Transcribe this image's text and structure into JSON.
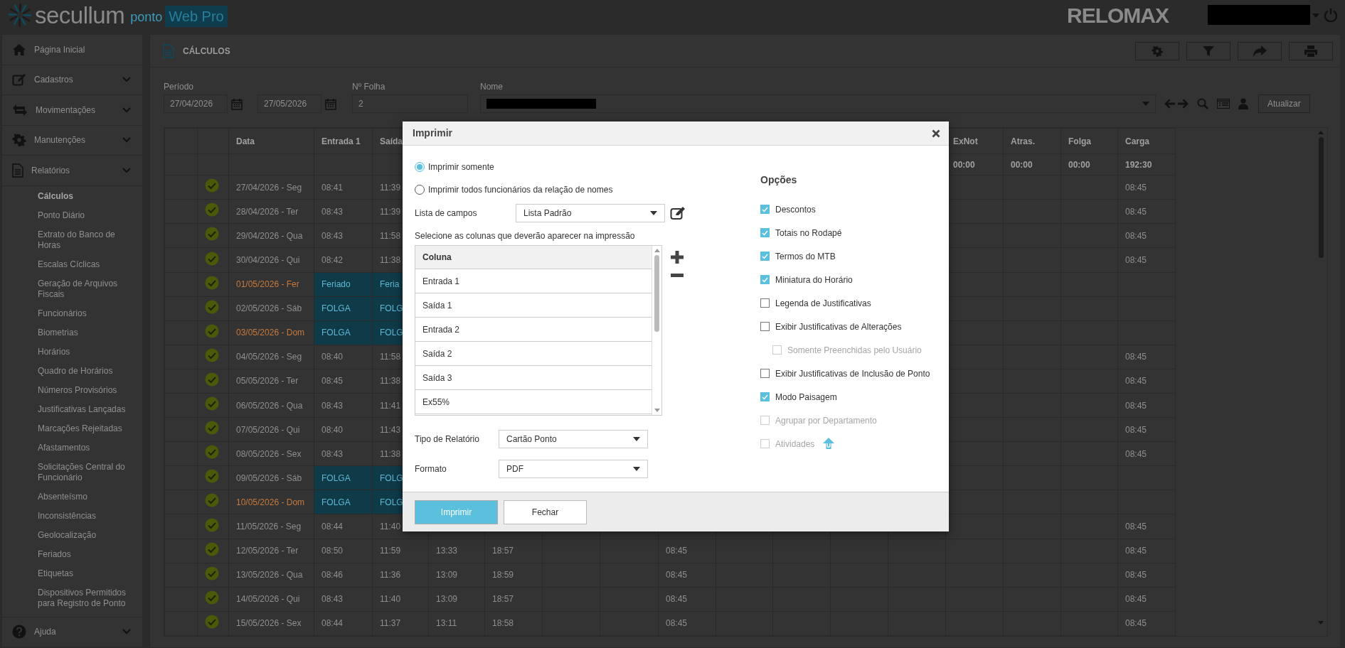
{
  "header": {
    "brand": "secullum",
    "product": "ponto",
    "edition": "Web Pro",
    "partner": "RELOMAX"
  },
  "sidebar": {
    "items": [
      {
        "label": "Página Inicial"
      },
      {
        "label": "Cadastros",
        "expanded": false
      },
      {
        "label": "Movimentações",
        "expanded": false
      },
      {
        "label": "Manutenções",
        "expanded": false
      },
      {
        "label": "Relatórios",
        "expanded": true,
        "children": [
          {
            "label": "Cálculos",
            "selected": true
          },
          {
            "label": "Ponto Diário",
            "selected": false
          },
          {
            "label": "Extrato do Banco de Horas",
            "selected": false
          },
          {
            "label": "Escalas Cíclicas",
            "selected": false
          },
          {
            "label": "Geração de Arquivos Fiscais",
            "selected": false
          },
          {
            "label": "Funcionários",
            "selected": false
          },
          {
            "label": "Biometrias",
            "selected": false
          },
          {
            "label": "Horários",
            "selected": false
          },
          {
            "label": "Quadro de Horários",
            "selected": false
          },
          {
            "label": "Números Provisórios",
            "selected": false
          },
          {
            "label": "Justificativas Lançadas",
            "selected": false
          },
          {
            "label": "Marcações Rejeitadas",
            "selected": false
          },
          {
            "label": "Afastamentos",
            "selected": false
          },
          {
            "label": "Solicitações Central do Funcionário",
            "selected": false
          },
          {
            "label": "Absenteísmo",
            "selected": false
          },
          {
            "label": "Inconsistências",
            "selected": false
          },
          {
            "label": "Geolocalização",
            "selected": false
          },
          {
            "label": "Feriados",
            "selected": false
          },
          {
            "label": "Etiquetas",
            "selected": false
          },
          {
            "label": "Dispositivos Permitidos para Registro de Ponto",
            "selected": false
          }
        ]
      },
      {
        "label": "Ajuda",
        "expanded": false
      }
    ]
  },
  "panel": {
    "title": "CÁLCULOS"
  },
  "filters": {
    "period_label": "Período",
    "date_from": "27/04/2026",
    "date_to": "27/05/2026",
    "sheet_label": "Nº Folha",
    "sheet": "2",
    "name_label": "Nome",
    "refresh": "Atualizar"
  },
  "table": {
    "columns": [
      "",
      "",
      "Data",
      "Entrada 1",
      "Saída",
      "",
      "",
      "",
      "",
      "",
      "",
      "",
      "",
      "",
      "ExNot",
      "Atras.",
      "Folga",
      "Carga"
    ],
    "rows": [
      {
        "kind": "totals",
        "cells": [
          "",
          "",
          "",
          "",
          "",
          "",
          "",
          "",
          "",
          "",
          "",
          "",
          "",
          "",
          "00:00",
          "00:00",
          "00:00",
          "192:30"
        ]
      },
      {
        "ok": true,
        "date_alert": false,
        "off": false,
        "cells": [
          "",
          "",
          "27/04/2026 - Seg",
          "08:41",
          "11:39",
          "",
          "",
          "",
          "",
          "",
          "",
          "",
          "",
          "",
          "",
          "",
          "",
          "08:45"
        ]
      },
      {
        "ok": true,
        "date_alert": false,
        "off": false,
        "cells": [
          "",
          "",
          "28/04/2026 - Ter",
          "08:43",
          "11:39",
          "",
          "",
          "",
          "",
          "",
          "",
          "",
          "",
          "",
          "",
          "",
          "",
          "08:45"
        ]
      },
      {
        "ok": true,
        "date_alert": false,
        "off": false,
        "cells": [
          "",
          "",
          "29/04/2026 - Qua",
          "08:43",
          "11:58",
          "",
          "",
          "",
          "",
          "",
          "",
          "",
          "",
          "",
          "",
          "",
          "",
          "08:45"
        ]
      },
      {
        "ok": true,
        "date_alert": false,
        "off": false,
        "cells": [
          "",
          "",
          "30/04/2026 - Qui",
          "08:42",
          "11:38",
          "",
          "",
          "",
          "",
          "",
          "",
          "",
          "",
          "",
          "",
          "",
          "",
          "08:45"
        ]
      },
      {
        "ok": true,
        "date_alert": true,
        "off": true,
        "cells": [
          "",
          "",
          "01/05/2026 - Fer",
          "Feriado",
          "Feria",
          "",
          "",
          "",
          "",
          "",
          "",
          "",
          "",
          "",
          "",
          "",
          "",
          ""
        ]
      },
      {
        "ok": true,
        "date_alert": false,
        "off": true,
        "cells": [
          "",
          "",
          "02/05/2026 - Sáb",
          "FOLGA",
          "FOLG",
          "",
          "",
          "",
          "",
          "",
          "",
          "",
          "",
          "",
          "",
          "",
          "",
          ""
        ]
      },
      {
        "ok": true,
        "date_alert": true,
        "off": true,
        "cells": [
          "",
          "",
          "03/05/2026 - Dom",
          "FOLGA",
          "FOLG",
          "",
          "",
          "",
          "",
          "",
          "",
          "",
          "",
          "",
          "",
          "",
          "",
          ""
        ]
      },
      {
        "ok": true,
        "date_alert": false,
        "off": false,
        "cells": [
          "",
          "",
          "04/05/2026 - Seg",
          "08:40",
          "11:58",
          "",
          "",
          "",
          "",
          "",
          "",
          "",
          "",
          "",
          "",
          "",
          "",
          "08:45"
        ]
      },
      {
        "ok": true,
        "date_alert": false,
        "off": false,
        "cells": [
          "",
          "",
          "05/05/2026 - Ter",
          "08:45",
          "11:38",
          "",
          "",
          "",
          "",
          "",
          "",
          "",
          "",
          "",
          "",
          "",
          "",
          "08:45"
        ]
      },
      {
        "ok": true,
        "date_alert": false,
        "off": false,
        "cells": [
          "",
          "",
          "06/05/2026 - Qua",
          "08:43",
          "11:41",
          "",
          "",
          "",
          "",
          "",
          "",
          "",
          "",
          "",
          "",
          "",
          "",
          "08:45"
        ]
      },
      {
        "ok": true,
        "date_alert": false,
        "off": false,
        "cells": [
          "",
          "",
          "07/05/2026 - Qui",
          "08:40",
          "11:43",
          "",
          "",
          "",
          "",
          "",
          "",
          "",
          "",
          "",
          "",
          "",
          "",
          "08:45"
        ]
      },
      {
        "ok": true,
        "date_alert": false,
        "off": false,
        "cells": [
          "",
          "",
          "08/05/2026 - Sex",
          "08:43",
          "11:38",
          "",
          "",
          "",
          "",
          "",
          "",
          "",
          "",
          "",
          "",
          "",
          "",
          "08:45"
        ]
      },
      {
        "ok": true,
        "date_alert": false,
        "off": true,
        "cells": [
          "",
          "",
          "09/05/2026 - Sáb",
          "FOLGA",
          "FOLG",
          "",
          "",
          "",
          "",
          "",
          "",
          "",
          "",
          "",
          "",
          "",
          "",
          ""
        ]
      },
      {
        "ok": true,
        "date_alert": true,
        "off": true,
        "cells": [
          "",
          "",
          "10/05/2026 - Dom",
          "FOLGA",
          "FOLG",
          "",
          "",
          "",
          "",
          "",
          "",
          "",
          "",
          "",
          "",
          "",
          "",
          ""
        ]
      },
      {
        "ok": true,
        "date_alert": false,
        "off": false,
        "cells": [
          "",
          "",
          "11/05/2026 - Seg",
          "08:44",
          "11:40",
          "",
          "",
          "",
          "",
          "",
          "",
          "",
          "",
          "",
          "",
          "",
          "",
          "08:45"
        ]
      },
      {
        "ok": true,
        "date_alert": false,
        "off": false,
        "cells": [
          "",
          "",
          "12/05/2026 - Ter",
          "08:50",
          "11:59",
          "13:33",
          "18:57",
          "",
          "",
          "08:45",
          "",
          "",
          "",
          "",
          "",
          "",
          "",
          "08:45"
        ]
      },
      {
        "ok": true,
        "date_alert": false,
        "off": false,
        "cells": [
          "",
          "",
          "13/05/2026 - Qua",
          "08:46",
          "11:36",
          "13:09",
          "18:59",
          "",
          "",
          "08:45",
          "",
          "",
          "",
          "",
          "",
          "",
          "",
          "08:45"
        ]
      },
      {
        "ok": true,
        "date_alert": false,
        "off": false,
        "cells": [
          "",
          "",
          "14/05/2026 - Qui",
          "08:43",
          "11:40",
          "13:09",
          "18:57",
          "",
          "",
          "08:45",
          "",
          "",
          "",
          "",
          "",
          "",
          "",
          "08:45"
        ]
      },
      {
        "ok": true,
        "date_alert": false,
        "off": false,
        "cells": [
          "",
          "",
          "15/05/2026 - Sex",
          "08:44",
          "11:37",
          "13:11",
          "18:58",
          "",
          "",
          "08:45",
          "",
          "",
          "",
          "",
          "",
          "",
          "",
          "08:45"
        ]
      }
    ]
  },
  "dialog": {
    "title": "Imprimir",
    "scope": [
      {
        "label": "Imprimir somente",
        "selected": true
      },
      {
        "label": "Imprimir todos funcionários da relação de nomes",
        "selected": false
      }
    ],
    "field_list": {
      "label": "Lista de campos",
      "value": "Lista Padrão"
    },
    "columns_hint": "Selecione as colunas que deverão aparecer na impressão",
    "columns_table": {
      "header": "Coluna",
      "rows": [
        "Entrada 1",
        "Saída 1",
        "Entrada 2",
        "Saída 2",
        "Saída 3",
        "Ex55%"
      ]
    },
    "report_type": {
      "label": "Tipo de Relatório",
      "value": "Cartão Ponto"
    },
    "format": {
      "label": "Formato",
      "value": "PDF"
    },
    "options_title": "Opções",
    "options": [
      {
        "label": "Descontos",
        "checked": true,
        "disabled": false
      },
      {
        "label": "Totais no Rodapé",
        "checked": true,
        "disabled": false
      },
      {
        "label": "Termos do MTB",
        "checked": true,
        "disabled": false
      },
      {
        "label": "Miniatura do Horário",
        "checked": true,
        "disabled": false
      },
      {
        "label": "Legenda de Justificativas",
        "checked": false,
        "disabled": false
      },
      {
        "label": "Exibir Justificativas de Alterações",
        "checked": false,
        "disabled": false,
        "children": [
          {
            "label": "Somente Preenchidas pelo Usuário",
            "checked": false,
            "disabled": true
          }
        ]
      },
      {
        "label": "Exibir Justificativas de Inclusão de Ponto",
        "checked": false,
        "disabled": false
      },
      {
        "label": "Modo Paisagem",
        "checked": true,
        "disabled": false
      },
      {
        "label": "Agrupar por Departamento",
        "checked": false,
        "disabled": true
      },
      {
        "label": "Atividades",
        "checked": false,
        "disabled": true
      }
    ],
    "buttons": [
      {
        "label": "Imprimir",
        "kind": "primary"
      },
      {
        "label": "Fechar",
        "kind": "secondary"
      }
    ]
  }
}
